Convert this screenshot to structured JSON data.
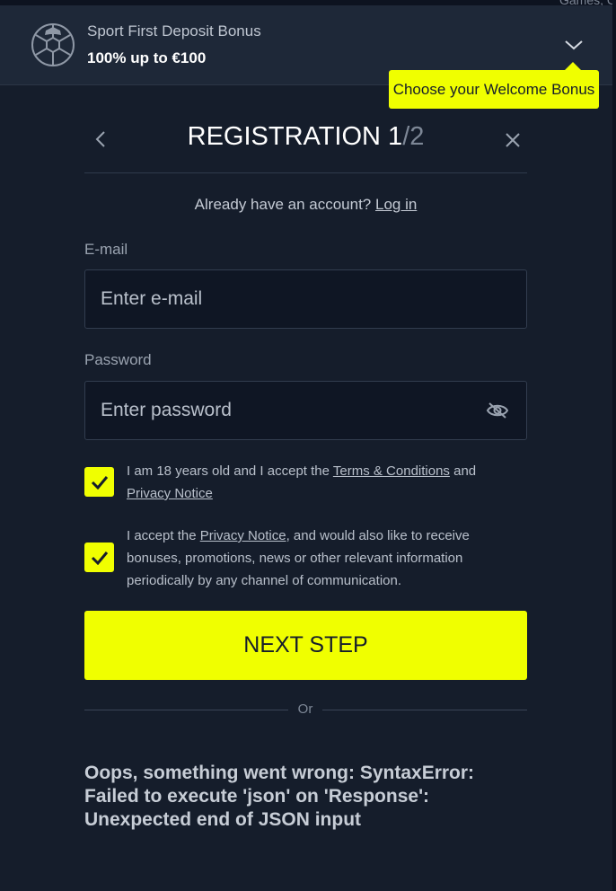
{
  "background_peek": "Games, C",
  "bonus": {
    "title": "Sport First Deposit Bonus",
    "amount": "100% up to €100",
    "tooltip": "Choose your Welcome Bonus"
  },
  "registration": {
    "title": "REGISTRATION 1",
    "step_total": "/2",
    "already_text": "Already have an account?",
    "login_link": "Log in",
    "email_label": "E-mail",
    "email_placeholder": "Enter e-mail",
    "email_value": "",
    "password_label": "Password",
    "password_placeholder": "Enter password",
    "password_value": "",
    "checkbox1": {
      "checked": true,
      "text_before": "I am 18 years old and I accept the ",
      "terms_link": "Terms & Conditions",
      "text_middle": " and",
      "privacy_link": "Privacy Notice"
    },
    "checkbox2": {
      "checked": true,
      "text_before": "I accept the ",
      "privacy_link": "Privacy Notice",
      "text_after": ", and would also like to receive bonuses, promotions, news or other relevant information periodically by any channel of communication."
    },
    "next_button": "NEXT STEP",
    "or_text": "Or",
    "error_message": "Oops, something went wrong: SyntaxError: Failed to execute 'json' on 'Response': Unexpected end of JSON input"
  },
  "colors": {
    "background": "#151d2b",
    "accent": "#f0ff00",
    "input_bg": "#0f1624"
  },
  "icons": [
    "soccer-ball-icon",
    "chevron-down-icon",
    "chevron-left-icon",
    "close-icon",
    "eye-off-icon",
    "checkmark-icon"
  ]
}
